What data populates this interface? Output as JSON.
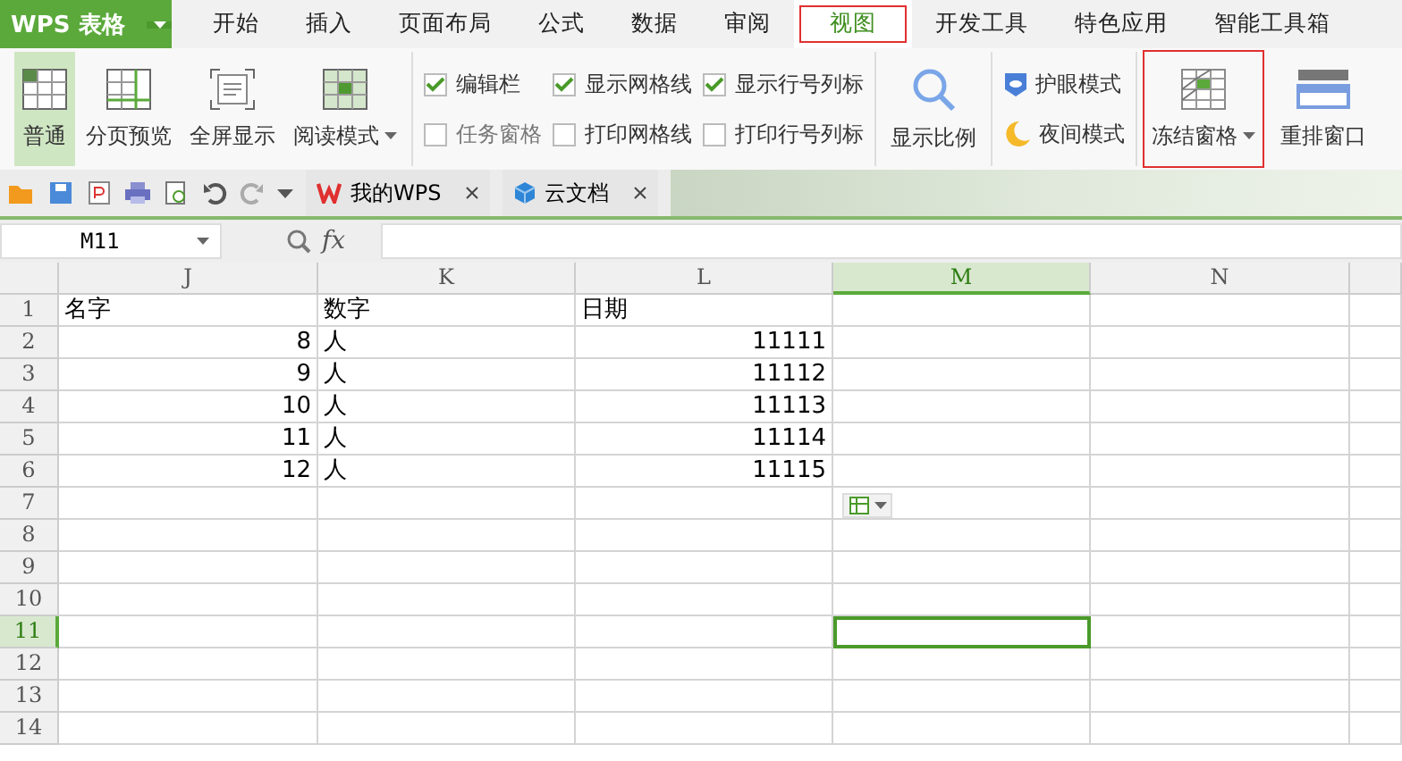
{
  "app_button": {
    "label": "WPS 表格"
  },
  "menu_tabs": [
    {
      "label": "开始",
      "selected": false,
      "annotated": false
    },
    {
      "label": "插入",
      "selected": false,
      "annotated": false
    },
    {
      "label": "页面布局",
      "selected": false,
      "annotated": false
    },
    {
      "label": "公式",
      "selected": false,
      "annotated": false
    },
    {
      "label": "数据",
      "selected": false,
      "annotated": false
    },
    {
      "label": "审阅",
      "selected": false,
      "annotated": false
    },
    {
      "label": "视图",
      "selected": true,
      "annotated": true
    },
    {
      "label": "开发工具",
      "selected": false,
      "annotated": false
    },
    {
      "label": "特色应用",
      "selected": false,
      "annotated": false
    },
    {
      "label": "智能工具箱",
      "selected": false,
      "annotated": false
    }
  ],
  "view_buttons": [
    {
      "label": "普通",
      "selected": true,
      "dropdown": false
    },
    {
      "label": "分页预览",
      "selected": false,
      "dropdown": false
    },
    {
      "label": "全屏显示",
      "selected": false,
      "dropdown": false
    },
    {
      "label": "阅读模式",
      "selected": false,
      "dropdown": true
    }
  ],
  "checkbox_columns": [
    [
      {
        "label": "编辑栏",
        "checked": true,
        "disabled": false
      },
      {
        "label": "任务窗格",
        "checked": false,
        "disabled": true
      }
    ],
    [
      {
        "label": "显示网格线",
        "checked": true,
        "disabled": false
      },
      {
        "label": "打印网格线",
        "checked": false,
        "disabled": false
      }
    ],
    [
      {
        "label": "显示行号列标",
        "checked": true,
        "disabled": false
      },
      {
        "label": "打印行号列标",
        "checked": false,
        "disabled": false
      }
    ]
  ],
  "zoom_button": {
    "label": "显示比例"
  },
  "mode_buttons": [
    {
      "label": "护眼模式",
      "kind": "eye"
    },
    {
      "label": "夜间模式",
      "kind": "night"
    }
  ],
  "window_buttons": [
    {
      "label": "冻结窗格",
      "dropdown": true,
      "annotated": true,
      "kind": "freeze"
    },
    {
      "label": "重排窗口",
      "dropdown": false,
      "annotated": false,
      "kind": "arrange"
    }
  ],
  "doc_tabs": [
    {
      "label": "我的WPS",
      "kind": "wps"
    },
    {
      "label": "云文档",
      "kind": "cloud"
    }
  ],
  "formula_bar": {
    "name_box": "M11",
    "fx": "fx"
  },
  "columns": [
    {
      "label": "J",
      "selected": false
    },
    {
      "label": "K",
      "selected": false
    },
    {
      "label": "L",
      "selected": false
    },
    {
      "label": "M",
      "selected": true
    },
    {
      "label": "N",
      "selected": false
    }
  ],
  "rows": [
    {
      "header": "1",
      "selected": false,
      "cells": [
        {
          "text": "名字",
          "kind": "text"
        },
        {
          "text": "数字",
          "kind": "text"
        },
        {
          "text": "日期",
          "kind": "text"
        }
      ]
    },
    {
      "header": "2",
      "selected": false,
      "cells": [
        {
          "text": "8",
          "kind": "number"
        },
        {
          "text": "人",
          "kind": "text"
        },
        {
          "text": "11111",
          "kind": "number"
        }
      ]
    },
    {
      "header": "3",
      "selected": false,
      "cells": [
        {
          "text": "9",
          "kind": "number"
        },
        {
          "text": "人",
          "kind": "text"
        },
        {
          "text": "11112",
          "kind": "number"
        }
      ]
    },
    {
      "header": "4",
      "selected": false,
      "cells": [
        {
          "text": "10",
          "kind": "number"
        },
        {
          "text": "人",
          "kind": "text"
        },
        {
          "text": "11113",
          "kind": "number"
        }
      ]
    },
    {
      "header": "5",
      "selected": false,
      "cells": [
        {
          "text": "11",
          "kind": "number"
        },
        {
          "text": "人",
          "kind": "text"
        },
        {
          "text": "11114",
          "kind": "number"
        }
      ]
    },
    {
      "header": "6",
      "selected": false,
      "cells": [
        {
          "text": "12",
          "kind": "number"
        },
        {
          "text": "人",
          "kind": "text"
        },
        {
          "text": "11115",
          "kind": "number"
        }
      ]
    },
    {
      "header": "7",
      "selected": false
    },
    {
      "header": "8",
      "selected": false
    },
    {
      "header": "9",
      "selected": false
    },
    {
      "header": "10",
      "selected": false
    },
    {
      "header": "11",
      "selected": true
    },
    {
      "header": "12",
      "selected": false
    },
    {
      "header": "13",
      "selected": false
    },
    {
      "header": "14",
      "selected": false
    }
  ]
}
